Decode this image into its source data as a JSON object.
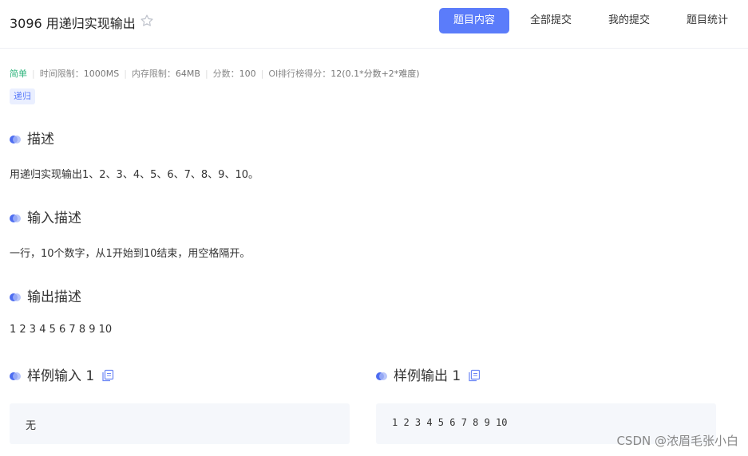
{
  "header": {
    "title": "3096 用递归实现输出",
    "tabs": [
      {
        "label": "题目内容",
        "active": true
      },
      {
        "label": "全部提交",
        "active": false
      },
      {
        "label": "我的提交",
        "active": false
      },
      {
        "label": "题目统计",
        "active": false
      }
    ]
  },
  "meta": {
    "difficulty": "简单",
    "time_label": "时间限制：",
    "time_value": "1000MS",
    "memory_label": "内存限制：",
    "memory_value": "64MB",
    "score_label": "分数：",
    "score_value": "100",
    "oi_label": "OI排行榜得分：",
    "oi_value": "12(0.1*分数+2*难度)"
  },
  "tags": [
    "递归"
  ],
  "sections": {
    "description": {
      "heading": "描述",
      "text": "用递归实现输出1、2、3、4、5、6、7、8、9、10。"
    },
    "input": {
      "heading": "输入描述",
      "text": "一行，10个数字，从1开始到10结束，用空格隔开。"
    },
    "output": {
      "heading": "输出描述",
      "text": "1 2 3 4 5 6 7 8 9 10"
    }
  },
  "samples": {
    "input_heading": "样例输入 1",
    "input_value": "无",
    "output_heading": "样例输出 1",
    "output_value": "1 2 3 4 5 6 7 8 9 10"
  },
  "watermark": "CSDN @浓眉毛张小白",
  "colors": {
    "accent": "#5b7cfa",
    "easy": "#2db47c"
  }
}
